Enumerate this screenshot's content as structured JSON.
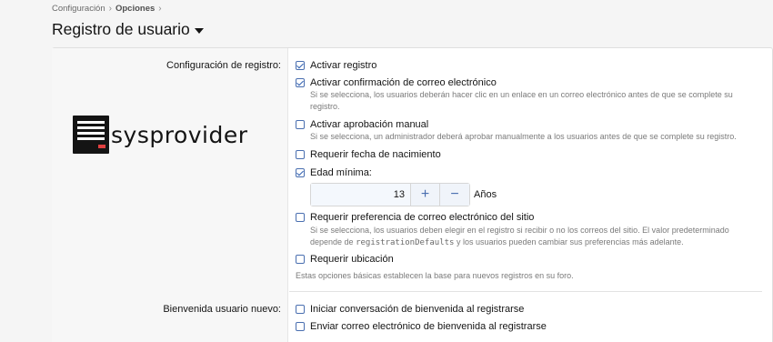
{
  "breadcrumb": {
    "items": [
      "Configuración",
      "Opciones"
    ]
  },
  "page": {
    "title": "Registro de usuario"
  },
  "registration": {
    "label": "Configuración de registro:",
    "options": [
      {
        "label": "Activar registro",
        "checked": true
      },
      {
        "label": "Activar confirmación de correo electrónico",
        "checked": true,
        "hint": "Si se selecciona, los usuarios deberán hacer clic en un enlace en un correo electrónico antes de que se complete su registro."
      },
      {
        "label": "Activar aprobación manual",
        "checked": false,
        "hint": "Si se selecciona, un administrador deberá aprobar manualmente a los usuarios antes de que se complete su registro."
      },
      {
        "label": "Requerir fecha de nacimiento",
        "checked": false
      },
      {
        "label": "Edad mínima:",
        "checked": true
      },
      {
        "label": "Requerir preferencia de correo electrónico del sitio",
        "checked": false,
        "hint_a": "Si se selecciona, los usuarios deben elegir en el registro si recibir o no los correos del sitio. El valor predeterminado depende de",
        "hint_code": "registrationDefaults",
        "hint_b": "y los usuarios pueden cambiar sus preferencias más adelante."
      },
      {
        "label": "Requerir ubicación",
        "checked": false
      }
    ],
    "min_age": {
      "value": "13",
      "plus": "+",
      "minus": "−",
      "unit": "Años"
    },
    "footer_hint": "Estas opciones básicas establecen la base para nuevos registros en su foro."
  },
  "welcome": {
    "label": "Bienvenida usuario nuevo:",
    "options": [
      {
        "label": "Iniciar conversación de bienvenida al registrarse",
        "checked": false
      },
      {
        "label": "Enviar correo electrónico de bienvenida al registrarse",
        "checked": false
      }
    ]
  },
  "logo": {
    "text": "sysprovider"
  }
}
